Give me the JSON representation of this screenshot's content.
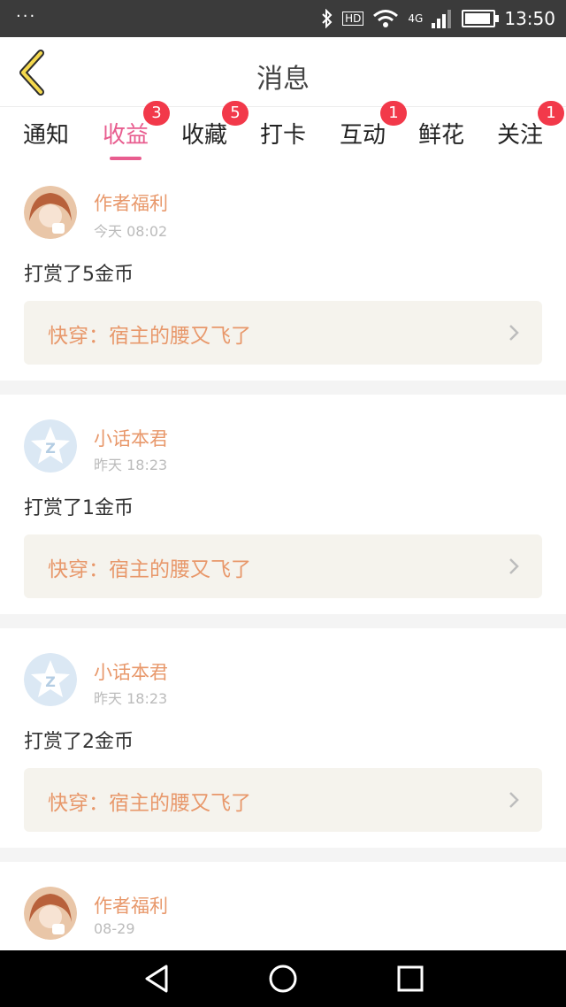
{
  "status_bar": {
    "time": "13:50",
    "network": "4G",
    "hd": "HD"
  },
  "header": {
    "title": "消息"
  },
  "tabs": [
    {
      "label": "通知",
      "badge": ""
    },
    {
      "label": "收益",
      "badge": "3"
    },
    {
      "label": "收藏",
      "badge": "5"
    },
    {
      "label": "打卡",
      "badge": ""
    },
    {
      "label": "互动",
      "badge": "1"
    },
    {
      "label": "鲜花",
      "badge": ""
    },
    {
      "label": "关注",
      "badge": "1"
    }
  ],
  "active_tab": "收益",
  "colors": {
    "accent": "#e85d8f",
    "name": "#e8986b",
    "badge": "#f2394a",
    "link_bg": "#f5f3ed"
  },
  "messages": [
    {
      "sender": "作者福利",
      "time": "今天 08:02",
      "text": "打赏了5金币",
      "book": "快穿：宿主的腰又飞了",
      "avatar": "anime-girl-avatar"
    },
    {
      "sender": "小话本君",
      "time": "昨天 18:23",
      "text": "打赏了1金币",
      "book": "快穿：宿主的腰又飞了",
      "avatar": "star-z-avatar"
    },
    {
      "sender": "小话本君",
      "time": "昨天 18:23",
      "text": "打赏了2金币",
      "book": "快穿：宿主的腰又飞了",
      "avatar": "star-z-avatar"
    },
    {
      "sender": "作者福利",
      "time": "08-29",
      "avatar": "anime-girl-avatar"
    }
  ]
}
